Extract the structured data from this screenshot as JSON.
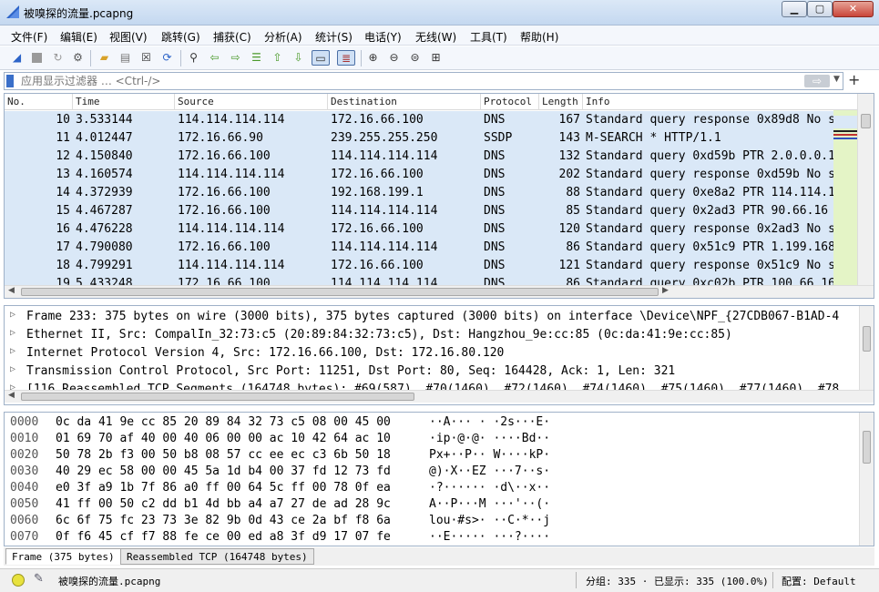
{
  "window": {
    "title": "被嗅探的流量.pcapng",
    "minimize": "▁",
    "maximize": "▢",
    "close": "✕"
  },
  "menu": [
    "文件(F)",
    "编辑(E)",
    "视图(V)",
    "跳转(G)",
    "捕获(C)",
    "分析(A)",
    "统计(S)",
    "电话(Y)",
    "无线(W)",
    "工具(T)",
    "帮助(H)"
  ],
  "toolbar_icons": [
    "shark-fin-start-icon",
    "stop-icon",
    "restart-icon",
    "options-gear-icon",
    "open-folder-icon",
    "save-file-icon",
    "close-file-icon",
    "reload-icon",
    "find-icon",
    "back-arrow-icon",
    "forward-arrow-icon",
    "goto-packet-icon",
    "first-packet-icon",
    "last-packet-icon",
    "autoscroll-icon",
    "colorize-icon",
    "zoom-in-icon",
    "zoom-out-icon",
    "zoom-normal-icon",
    "resize-columns-icon"
  ],
  "filter": {
    "placeholder": "应用显示过滤器 … <Ctrl-/>",
    "apply": "⇨",
    "dropdown": "▼",
    "add": "+"
  },
  "columns": [
    "No.",
    "Time",
    "Source",
    "Destination",
    "Protocol",
    "Length",
    "Info"
  ],
  "packets": [
    {
      "no": "10",
      "time": "3.533144",
      "src": "114.114.114.114",
      "dst": "172.16.66.100",
      "proto": "DNS",
      "len": "167",
      "info": "Standard query response 0x89d8 No s"
    },
    {
      "no": "11",
      "time": "4.012447",
      "src": "172.16.66.90",
      "dst": "239.255.255.250",
      "proto": "SSDP",
      "len": "143",
      "info": "M-SEARCH * HTTP/1.1"
    },
    {
      "no": "12",
      "time": "4.150840",
      "src": "172.16.66.100",
      "dst": "114.114.114.114",
      "proto": "DNS",
      "len": "132",
      "info": "Standard query 0xd59b PTR 2.0.0.0.1"
    },
    {
      "no": "13",
      "time": "4.160574",
      "src": "114.114.114.114",
      "dst": "172.16.66.100",
      "proto": "DNS",
      "len": "202",
      "info": "Standard query response 0xd59b No s"
    },
    {
      "no": "14",
      "time": "4.372939",
      "src": "172.16.66.100",
      "dst": "192.168.199.1",
      "proto": "DNS",
      "len": "88",
      "info": "Standard query 0xe8a2 PTR 114.114.1"
    },
    {
      "no": "15",
      "time": "4.467287",
      "src": "172.16.66.100",
      "dst": "114.114.114.114",
      "proto": "DNS",
      "len": "85",
      "info": "Standard query 0x2ad3 PTR 90.66.16"
    },
    {
      "no": "16",
      "time": "4.476228",
      "src": "114.114.114.114",
      "dst": "172.16.66.100",
      "proto": "DNS",
      "len": "120",
      "info": "Standard query response 0x2ad3 No s"
    },
    {
      "no": "17",
      "time": "4.790080",
      "src": "172.16.66.100",
      "dst": "114.114.114.114",
      "proto": "DNS",
      "len": "86",
      "info": "Standard query 0x51c9 PTR 1.199.168"
    },
    {
      "no": "18",
      "time": "4.799291",
      "src": "114.114.114.114",
      "dst": "172.16.66.100",
      "proto": "DNS",
      "len": "121",
      "info": "Standard query response 0x51c9 No s"
    },
    {
      "no": "19",
      "time": "5.433248",
      "src": "172.16.66.100",
      "dst": "114.114.114.114",
      "proto": "DNS",
      "len": "86",
      "info": "Standard query 0xc02b PTR 100.66.16"
    }
  ],
  "details": [
    "Frame 233: 375 bytes on wire (3000 bits), 375 bytes captured (3000 bits) on interface \\Device\\NPF_{27CDB067-B1AD-4",
    "Ethernet II, Src: CompalIn_32:73:c5 (20:89:84:32:73:c5), Dst: Hangzhou_9e:cc:85 (0c:da:41:9e:cc:85)",
    "Internet Protocol Version 4, Src: 172.16.66.100, Dst: 172.16.80.120",
    "Transmission Control Protocol, Src Port: 11251, Dst Port: 80, Seq: 164428, Ack: 1, Len: 321",
    "[116 Reassembled TCP Segments (164748 bytes): #69(587), #70(1460), #72(1460), #74(1460), #75(1460), #77(1460), #78"
  ],
  "bytes": [
    {
      "off": "0000",
      "hex": "0c da 41 9e cc 85 20 89  84 32 73 c5 08 00 45 00",
      "ascii": "··A··· · ·2s···E·"
    },
    {
      "off": "0010",
      "hex": "01 69 70 af 40 00 40 06  00 00 ac 10 42 64 ac 10",
      "ascii": "·ip·@·@· ····Bd··"
    },
    {
      "off": "0020",
      "hex": "50 78 2b f3 00 50 b8 08  57 cc ee ec c3 6b 50 18",
      "ascii": "Px+··P·· W····kP·"
    },
    {
      "off": "0030",
      "hex": "40 29 ec 58 00 00 45 5a  1d b4 00 37 fd 12 73 fd",
      "ascii": "@)·X··EZ ···7··s·"
    },
    {
      "off": "0040",
      "hex": "e0 3f a9 1b 7f 86 a0 ff  00 64 5c ff 00 78 0f ea",
      "ascii": "·?······ ·d\\··x··"
    },
    {
      "off": "0050",
      "hex": "41 ff 00 50 c2 dd b1 4d  bb a4 a7 27 de ad 28 9c",
      "ascii": "A··P···M ···'··(·"
    },
    {
      "off": "0060",
      "hex": "6c 6f 75 fc 23 73 3e 82  9b 0d 43 ce 2a bf f8 6a",
      "ascii": "lou·#s>· ··C·*··j"
    },
    {
      "off": "0070",
      "hex": "0f f6 45 cf f7 88 fe ce  00 ed a8 3f d9 17 07 fe",
      "ascii": "··E····· ···?····"
    }
  ],
  "byte_tabs": [
    "Frame (375 bytes)",
    "Reassembled TCP (164748 bytes)"
  ],
  "status": {
    "file": "被嗅探的流量.pcapng",
    "packets": "分组: 335 · 已显示: 335 (100.0%)",
    "profile": "配置: Default"
  },
  "colors": {
    "row_bg": "#dae8f7",
    "minimap": "#e4f4c6",
    "filter_bookmark": "#3a6fc9",
    "status_led": "#e8e23e"
  }
}
